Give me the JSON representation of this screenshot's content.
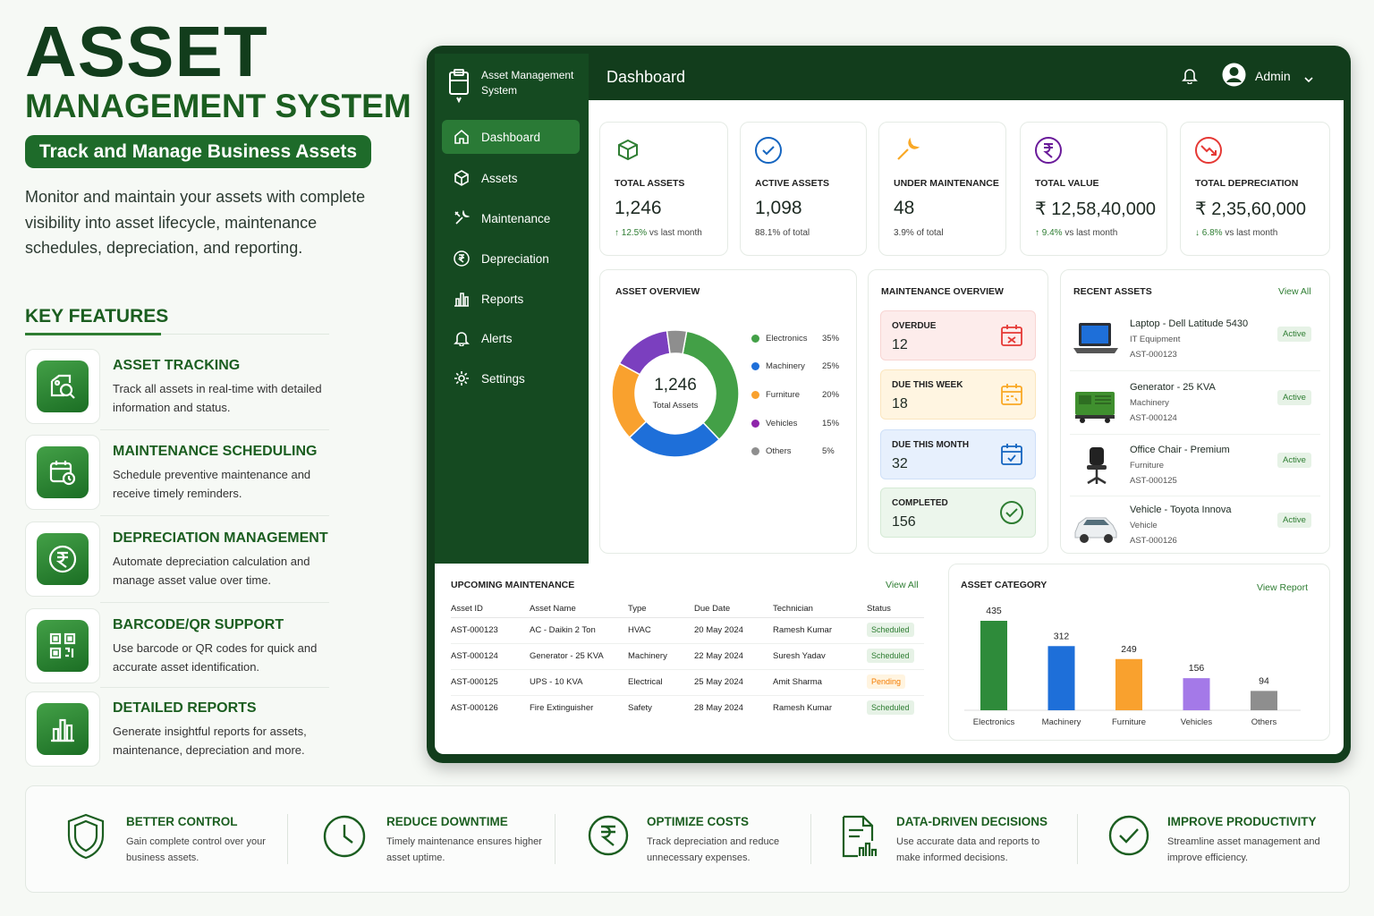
{
  "hero": {
    "title": "ASSET",
    "subtitle": "MANAGEMENT SYSTEM",
    "tagline": "Track and Manage Business Assets",
    "intro": "Monitor and maintain your assets with complete visibility into asset lifecycle, maintenance schedules, depreciation, and reporting."
  },
  "key_features": {
    "title": "KEY FEATURES",
    "items": [
      {
        "title": "ASSET TRACKING",
        "desc": "Track all assets in real-time with detailed information and status.",
        "icon": "asset-search-icon"
      },
      {
        "title": "MAINTENANCE SCHEDULING",
        "desc": "Schedule preventive maintenance and receive timely reminders.",
        "icon": "calendar-clock-icon"
      },
      {
        "title": "DEPRECIATION MANAGEMENT",
        "desc": "Automate depreciation calculation and manage asset value over time.",
        "icon": "rupee-icon"
      },
      {
        "title": "BARCODE/QR SUPPORT",
        "desc": "Use barcode or QR codes for quick and accurate asset identification.",
        "icon": "qr-code-icon"
      },
      {
        "title": "DETAILED REPORTS",
        "desc": "Generate insightful reports for assets, maintenance, depreciation and more.",
        "icon": "bar-chart-icon"
      }
    ]
  },
  "app": {
    "logo_text": "Asset Management System",
    "page_title": "Dashboard",
    "user": "Admin",
    "nav": [
      {
        "label": "Dashboard",
        "icon": "home-icon",
        "active": true
      },
      {
        "label": "Assets",
        "icon": "cube-icon"
      },
      {
        "label": "Maintenance",
        "icon": "wrench-icon"
      },
      {
        "label": "Depreciation",
        "icon": "rupee-circle-icon"
      },
      {
        "label": "Reports",
        "icon": "bar-chart-icon"
      },
      {
        "label": "Alerts",
        "icon": "bell-icon"
      },
      {
        "label": "Settings",
        "icon": "gear-icon"
      }
    ]
  },
  "stats": [
    {
      "label": "TOTAL ASSETS",
      "value": "1,246",
      "trend": "↑ 12.5%",
      "sub": " vs last month",
      "color": "#2e7d32"
    },
    {
      "label": "ACTIVE ASSETS",
      "value": "1,098",
      "trend": "",
      "sub": "88.1% of total",
      "color": "#1565c0"
    },
    {
      "label": "UNDER MAINTENANCE",
      "value": "48",
      "trend": "",
      "sub": "3.9% of total",
      "color": "#f9a825"
    },
    {
      "label": "TOTAL VALUE",
      "value": "₹ 12,58,40,000",
      "trend": "↑ 9.4%",
      "sub": " vs last month",
      "color": "#6a1b9a"
    },
    {
      "label": "TOTAL DEPRECIATION",
      "value": "₹ 2,35,60,000",
      "trend": "↓ 6.8%",
      "sub": " vs last month",
      "color": "#e53935"
    }
  ],
  "asset_overview": {
    "title": "ASSET OVERVIEW",
    "center_value": "1,246",
    "center_label": "Total Assets"
  },
  "chart_data": [
    {
      "type": "pie",
      "title": "ASSET OVERVIEW",
      "categories": [
        "Electronics",
        "Machinery",
        "Furniture",
        "Vehicles",
        "Others"
      ],
      "values": [
        35,
        25,
        20,
        15,
        5
      ],
      "labels": [
        "35%",
        "25%",
        "20%",
        "15%",
        "5%"
      ],
      "colors": [
        "#43a047",
        "#1e6fd9",
        "#f9a12e",
        "#7b3fbf",
        "#8e8e8e"
      ],
      "legend": "right"
    },
    {
      "type": "bar",
      "title": "ASSET CATEGORY",
      "categories": [
        "Electronics",
        "Machinery",
        "Furniture",
        "Vehicles",
        "Others"
      ],
      "values": [
        435,
        312,
        249,
        156,
        94
      ],
      "colors": [
        "#2e8b3a",
        "#1e6fd9",
        "#f9a12e",
        "#a479e8",
        "#8e8e8e"
      ],
      "ylim": [
        0,
        435
      ]
    }
  ],
  "maintenance_overview": {
    "title": "MAINTENANCE OVERVIEW",
    "items": [
      {
        "label": "OVERDUE",
        "value": "12",
        "bg": "#fdeceb",
        "color": "#e53935",
        "icon": "calendar-alert-icon"
      },
      {
        "label": "DUE THIS WEEK",
        "value": "18",
        "bg": "#fff5e1",
        "color": "#f9a825",
        "icon": "calendar-week-icon"
      },
      {
        "label": "DUE THIS MONTH",
        "value": "32",
        "bg": "#e7f0fd",
        "color": "#1565c0",
        "icon": "calendar-month-icon"
      },
      {
        "label": "COMPLETED",
        "value": "156",
        "bg": "#ecf6ec",
        "color": "#2e7d32",
        "icon": "check-circle-icon"
      }
    ]
  },
  "recent_assets": {
    "title": "RECENT ASSETS",
    "view_all": "View All",
    "items": [
      {
        "name": "Laptop - Dell Latitude 5430",
        "category": "IT Equipment",
        "id": "AST-000123",
        "status": "Active",
        "img": "laptop-image"
      },
      {
        "name": "Generator - 25 KVA",
        "category": "Machinery",
        "id": "AST-000124",
        "status": "Active",
        "img": "generator-image"
      },
      {
        "name": "Office Chair - Premium",
        "category": "Furniture",
        "id": "AST-000125",
        "status": "Active",
        "img": "chair-image"
      },
      {
        "name": "Vehicle - Toyota Innova",
        "category": "Vehicle",
        "id": "AST-000126",
        "status": "Active",
        "img": "car-image"
      }
    ]
  },
  "upcoming_maintenance": {
    "title": "UPCOMING MAINTENANCE",
    "view_all": "View All",
    "columns": [
      "Asset ID",
      "Asset Name",
      "Type",
      "Due Date",
      "Technician",
      "Status"
    ],
    "rows": [
      [
        "AST-000123",
        "AC - Daikin 2 Ton",
        "HVAC",
        "20 May 2024",
        "Ramesh Kumar",
        "Scheduled"
      ],
      [
        "AST-000124",
        "Generator - 25 KVA",
        "Machinery",
        "22 May 2024",
        "Suresh Yadav",
        "Scheduled"
      ],
      [
        "AST-000125",
        "UPS - 10 KVA",
        "Electrical",
        "25 May 2024",
        "Amit Sharma",
        "Pending"
      ],
      [
        "AST-000126",
        "Fire Extinguisher",
        "Safety",
        "28 May 2024",
        "Ramesh Kumar",
        "Scheduled"
      ]
    ]
  },
  "asset_category": {
    "title": "ASSET CATEGORY",
    "view_report": "View Report"
  },
  "benefits": [
    {
      "title": "BETTER CONTROL",
      "desc": "Gain complete control over your business assets.",
      "icon": "shield-icon"
    },
    {
      "title": "REDUCE DOWNTIME",
      "desc": "Timely maintenance ensures higher asset uptime.",
      "icon": "clock-icon"
    },
    {
      "title": "OPTIMIZE COSTS",
      "desc": "Track depreciation and reduce unnecessary expenses.",
      "icon": "rupee-circle-icon"
    },
    {
      "title": "DATA-DRIVEN DECISIONS",
      "desc": "Use accurate data and reports to make informed decisions.",
      "icon": "report-chart-icon"
    },
    {
      "title": "IMPROVE PRODUCTIVITY",
      "desc": "Streamline asset management and improve efficiency.",
      "icon": "check-circle-icon"
    }
  ]
}
